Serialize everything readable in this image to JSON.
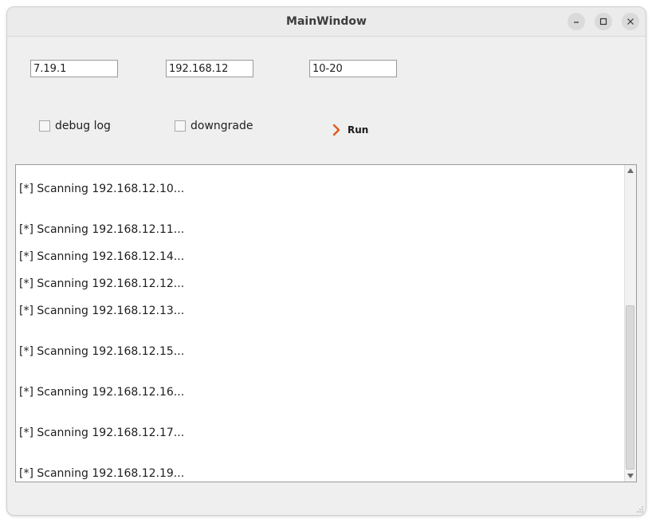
{
  "window": {
    "title": "MainWindow"
  },
  "inputs": {
    "version": "7.19.1",
    "subnet": "192.168.12",
    "range": "10-20"
  },
  "options": {
    "debug_log_label": "debug log",
    "debug_log_checked": false,
    "downgrade_label": "downgrade",
    "downgrade_checked": false
  },
  "run_button": {
    "label": "Run",
    "icon": "chevron-right-icon",
    "icon_color": "#e05a1b"
  },
  "log": {
    "lines": [
      "[*] Scanning 192.168.12.10...",
      "[*] Scanning 192.168.12.11...",
      "[*] Scanning 192.168.12.14...",
      "[*] Scanning 192.168.12.12...",
      "[*] Scanning 192.168.12.13...",
      "[*] Scanning 192.168.12.15...",
      "[*] Scanning 192.168.12.16...",
      "[*] Scanning 192.168.12.17...",
      "[*] Scanning 192.168.12.19..."
    ]
  }
}
